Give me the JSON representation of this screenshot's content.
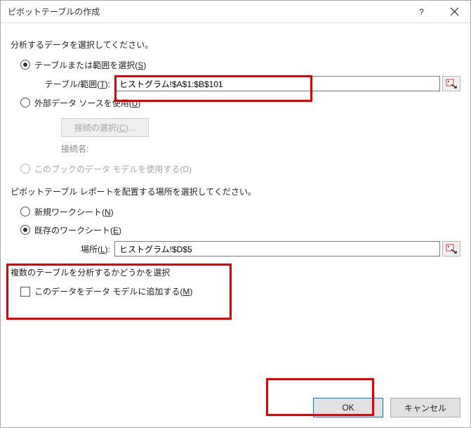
{
  "title": "ピボットテーブルの作成",
  "section_analyze": "分析するデータを選択してください。",
  "radio_table_range": "テーブルまたは範囲を選択(",
  "radio_table_range_u": "S",
  "radio_table_range_end": ")",
  "label_table_range_pre": "テーブル/範囲(",
  "label_table_range_u": "T",
  "label_table_range_post": "):",
  "input_table_range": "ヒストグラム!$A$1:$B$101",
  "radio_external": "外部データ ソースを使用(",
  "radio_external_u": "U",
  "radio_external_end": ")",
  "btn_choose_conn": "接続の選択(",
  "btn_choose_conn_u": "C",
  "btn_choose_conn_end": ")...",
  "conn_name_label": "接続名:",
  "radio_datamodel_use": "このブックのデータ モデルを使用する(",
  "radio_datamodel_use_u": "D",
  "radio_datamodel_use_end": ")",
  "section_place": "ピボットテーブル レポートを配置する場所を選択してください。",
  "radio_new_ws": "新規ワークシート(",
  "radio_new_ws_u": "N",
  "radio_new_ws_end": ")",
  "radio_existing_ws": "既存のワークシート(",
  "radio_existing_ws_u": "E",
  "radio_existing_ws_end": ")",
  "label_location_pre": "場所(",
  "label_location_u": "L",
  "label_location_post": "):",
  "input_location": "ヒストグラム!$D$5",
  "section_multi": "複数のテーブルを分析するかどうかを選択",
  "chk_add_model": "このデータをデータ モデルに追加する(",
  "chk_add_model_u": "M",
  "chk_add_model_end": ")",
  "btn_ok": "OK",
  "btn_cancel": "キャンセル"
}
